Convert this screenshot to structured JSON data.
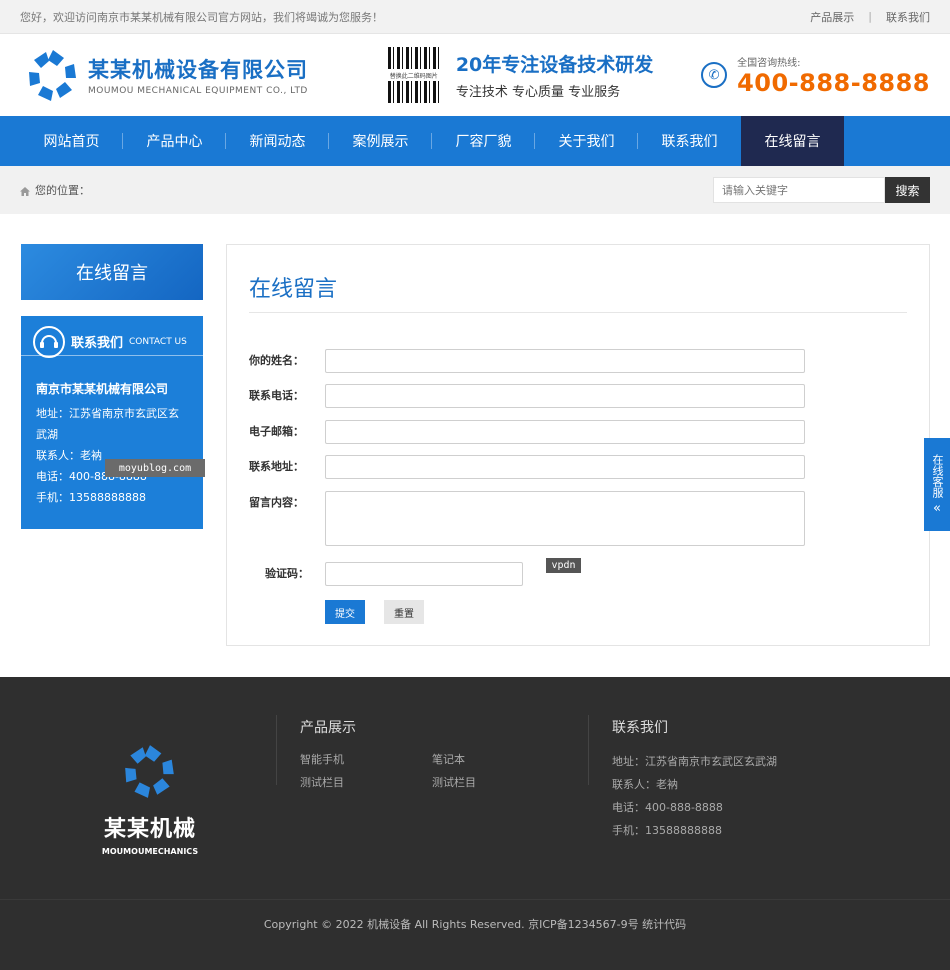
{
  "topbar": {
    "welcome": "您好，欢迎访问南京市某某机械有限公司官方网站，我们将竭诚为您服务！",
    "link1": "产品展示",
    "link2": "联系我们"
  },
  "header": {
    "logo_cn": "某某机械设备有限公司",
    "logo_en": "MOUMOU MECHANICAL EQUIPMENT CO., LTD",
    "qr_caption": "替换此二维码图片",
    "slogan_big": "20年专注设备技术研发",
    "slogan_small": "专注技术 专心质量 专业服务",
    "hotline_label": "全国咨询热线:",
    "hotline_number": "400-888-8888"
  },
  "nav": {
    "items": [
      "网站首页",
      "产品中心",
      "新闻动态",
      "案例展示",
      "厂容厂貌",
      "关于我们",
      "联系我们",
      "在线留言"
    ],
    "active_index": 7
  },
  "crumb": {
    "label": "您的位置：",
    "search_placeholder": "请输入关键字",
    "search_button": "搜索"
  },
  "sidebar": {
    "title": "在线留言",
    "contact_title": "联系我们",
    "contact_sub": "CONTACT US",
    "company": "南京市某某机械有限公司",
    "address": "地址：江苏省南京市玄武区玄武湖",
    "contact_person": "联系人：老衲",
    "phone": "电话：400-888-8888",
    "mobile": "手机：13588888888"
  },
  "watermark": "moyublog.com",
  "form": {
    "title": "在线留言",
    "name_label": "你的姓名：",
    "phone_label": "联系电话：",
    "email_label": "电子邮箱：",
    "address_label": "联系地址：",
    "content_label": "留言内容：",
    "captcha_label": "验证码：",
    "captcha_text": "vpdn",
    "submit": "提交",
    "reset": "重置"
  },
  "float_service": "在线客服",
  "footer": {
    "logo_cn": "某某机械",
    "logo_en": "MOUMOUMECHANICS",
    "products_title": "产品展示",
    "links": [
      "智能手机",
      "笔记本",
      "测试栏目",
      "测试栏目"
    ],
    "contact_title": "联系我们",
    "address": "地址：江苏省南京市玄武区玄武湖",
    "contact_person": "联系人：老衲",
    "phone": "电话：400-888-8888",
    "mobile": "手机：13588888888",
    "copyright": "Copyright © 2022 机械设备 All Rights Reserved. 京ICP备1234567-9号 统计代码"
  },
  "colors": {
    "brand_blue": "#1a79d4",
    "nav_active": "#1f2950",
    "hotline_orange": "#f06a00",
    "footer_bg": "#2f2f2f"
  }
}
